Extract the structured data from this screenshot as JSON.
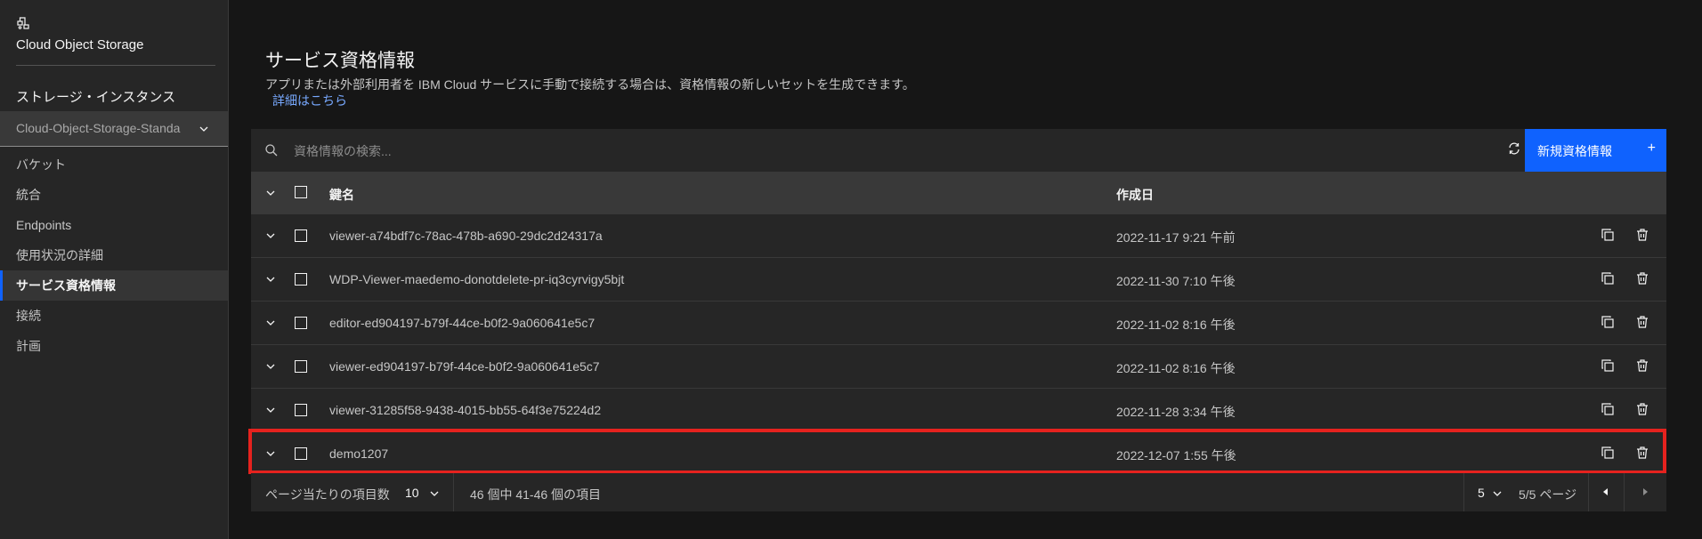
{
  "sidebar": {
    "service_title": "Cloud Object Storage",
    "instances_label": "ストレージ・インスタンス",
    "instance_select": "Cloud-Object-Storage-Standa",
    "items": [
      {
        "label": "バケット"
      },
      {
        "label": "統合"
      },
      {
        "label": "Endpoints"
      },
      {
        "label": "使用状況の詳細"
      },
      {
        "label": "サービス資格情報"
      },
      {
        "label": "接続"
      },
      {
        "label": "計画"
      }
    ]
  },
  "page": {
    "title": "サービス資格情報",
    "description": "アプリまたは外部利用者を IBM Cloud サービスに手動で接続する場合は、資格情報の新しいセットを生成できます。",
    "link": "詳細はこちら"
  },
  "toolbar": {
    "search_placeholder": "資格情報の検索...",
    "new_button": "新規資格情報",
    "new_button_icon": "+"
  },
  "table": {
    "headers": {
      "name": "鍵名",
      "date": "作成日"
    },
    "rows": [
      {
        "name": "viewer-a74bdf7c-78ac-478b-a690-29dc2d24317a",
        "date": "2022-11-17 9:21 午前"
      },
      {
        "name": "WDP-Viewer-maedemo-donotdelete-pr-iq3cyrvigy5bjt",
        "date": "2022-11-30 7:10 午後"
      },
      {
        "name": "editor-ed904197-b79f-44ce-b0f2-9a060641e5c7",
        "date": "2022-11-02 8:16 午後"
      },
      {
        "name": "viewer-ed904197-b79f-44ce-b0f2-9a060641e5c7",
        "date": "2022-11-02 8:16 午後"
      },
      {
        "name": "viewer-31285f58-9438-4015-bb55-64f3e75224d2",
        "date": "2022-11-28 3:34 午後"
      },
      {
        "name": "demo1207",
        "date": "2022-12-07 1:55 午後"
      }
    ]
  },
  "pagination": {
    "per_page_label": "ページ当たりの項目数",
    "per_page_value": "10",
    "range_text": "46 個中 41-46 個の項目",
    "current_page": "5",
    "pages_text": "5/5 ページ"
  },
  "colors": {
    "accent": "#0f62fe",
    "highlight": "#e5221e",
    "link": "#78a9ff"
  }
}
